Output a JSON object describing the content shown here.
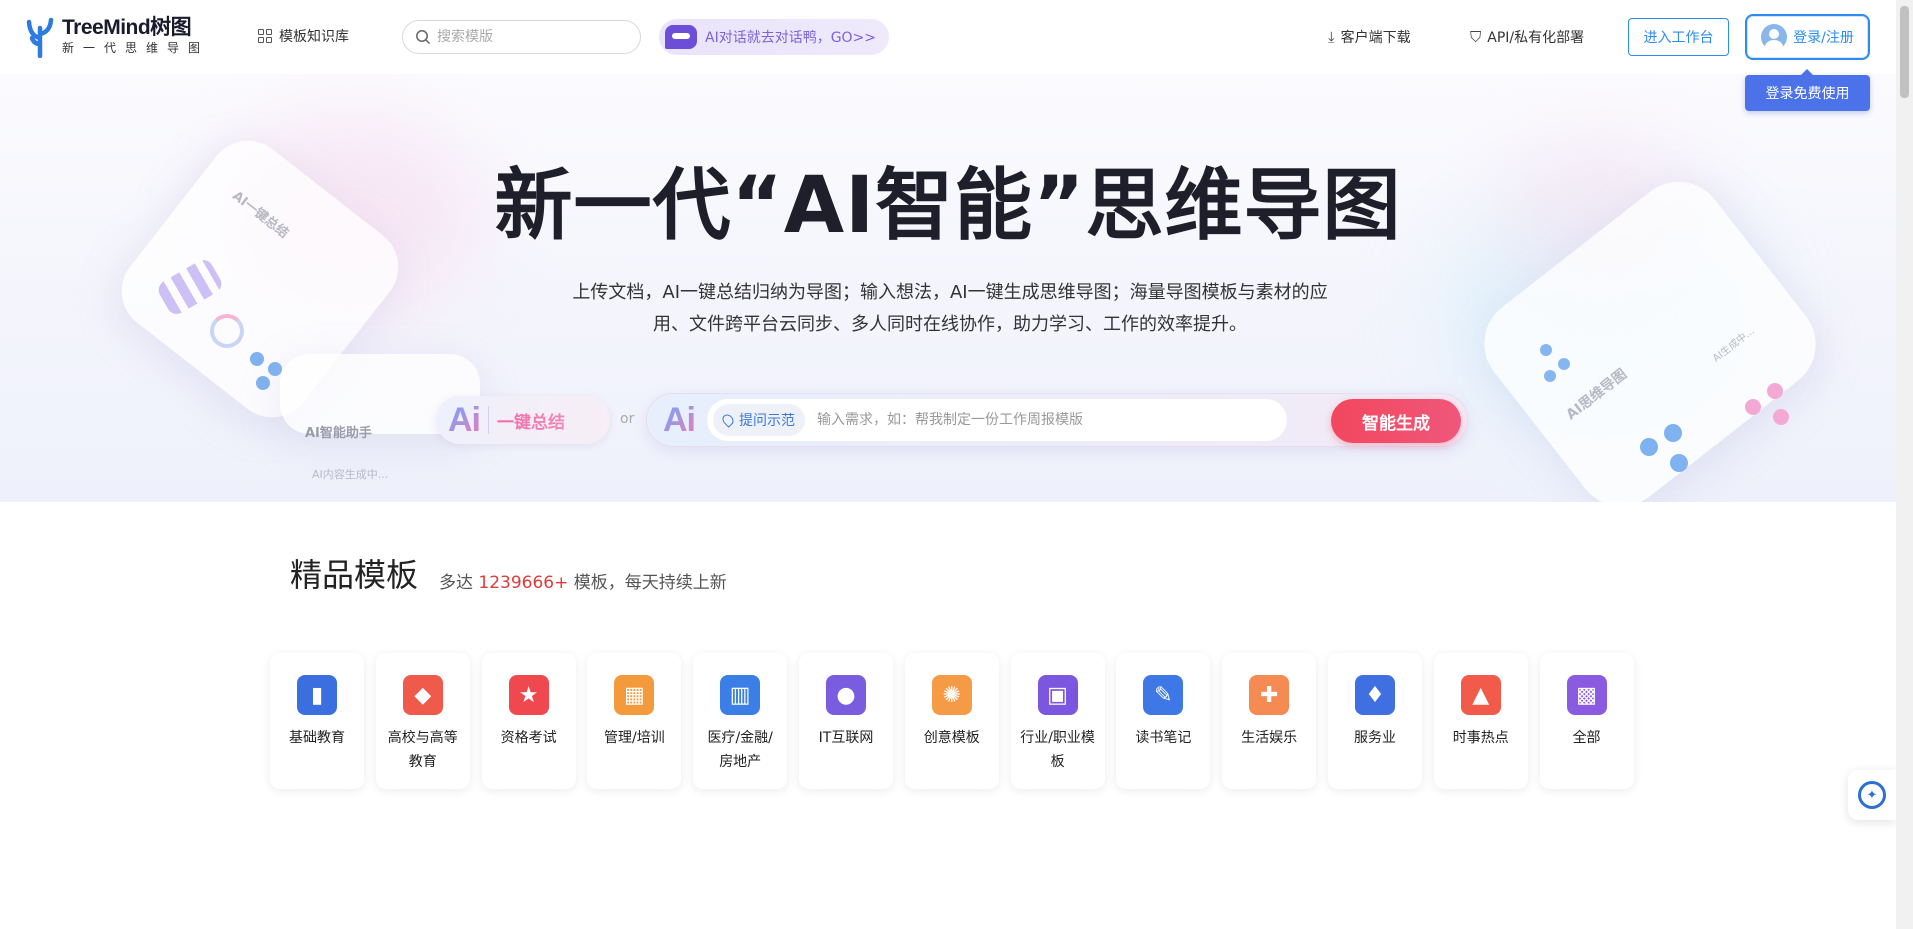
{
  "header": {
    "logo_main": "TreeMind树图",
    "logo_sub": "新一代思维导图",
    "nav_library": "模板知识库",
    "search_placeholder": "搜索模版",
    "ai_chat": "AI对话就去对话鸭，GO>>",
    "download": "客户端下载",
    "api": "API/私有化部署",
    "workspace": "进入工作台",
    "login": "登录/注册",
    "tooltip": "登录免费使用"
  },
  "hero": {
    "title": "新一代“AI智能”思维导图",
    "desc_line1": "上传文档，AI一键总结归纳为导图；输入想法，AI一键生成思维导图；海量导图模板与素材的应",
    "desc_line2": "用、文件跨平台云同步、多人同时在线协作，助力学习、工作的效率提升。",
    "ai_logo": "Ai",
    "summary_label": "一键总结",
    "or": "or",
    "hint_tag": "提问示范",
    "input_placeholder": "输入需求，如：帮我制定一份工作周报模版",
    "generate": "智能生成",
    "deco_left_1": "AI一键总结",
    "deco_left_2": "AI智能助手",
    "deco_left_3": "AI内容生成中...",
    "deco_right_1": "AI思维导图",
    "deco_right_2": "AI生成中..."
  },
  "templates": {
    "title": "精品模板",
    "sub_prefix": "多达 ",
    "count": "1239666+",
    "sub_suffix": " 模板，每天持续上新",
    "categories": [
      {
        "name": "基础教育",
        "icon": "book-icon",
        "color": "#3b6fe0"
      },
      {
        "name": "高校与高等教育",
        "icon": "graduation-cap-icon",
        "color": "#f05a4a"
      },
      {
        "name": "资格考试",
        "icon": "badge-star-icon",
        "color": "#f0484f"
      },
      {
        "name": "管理/培训",
        "icon": "presentation-icon",
        "color": "#f39a3c"
      },
      {
        "name": "医疗/金融/房地产",
        "icon": "building-icon",
        "color": "#3a7ee6"
      },
      {
        "name": "IT互联网",
        "icon": "planet-icon",
        "color": "#7a5ce0"
      },
      {
        "name": "创意模板",
        "icon": "lightbulb-icon",
        "color": "#f59a45"
      },
      {
        "name": "行业/职业模板",
        "icon": "briefcase-icon",
        "color": "#7b57df"
      },
      {
        "name": "读书笔记",
        "icon": "notebook-pen-icon",
        "color": "#3d78e6"
      },
      {
        "name": "生活娱乐",
        "icon": "gamepad-icon",
        "color": "#f58a52"
      },
      {
        "name": "服务业",
        "icon": "waiter-icon",
        "color": "#3f6fe0"
      },
      {
        "name": "时事热点",
        "icon": "flame-icon",
        "color": "#f25a4a"
      },
      {
        "name": "全部",
        "icon": "apps-grid-icon",
        "color": "#8a5ae0"
      }
    ]
  }
}
